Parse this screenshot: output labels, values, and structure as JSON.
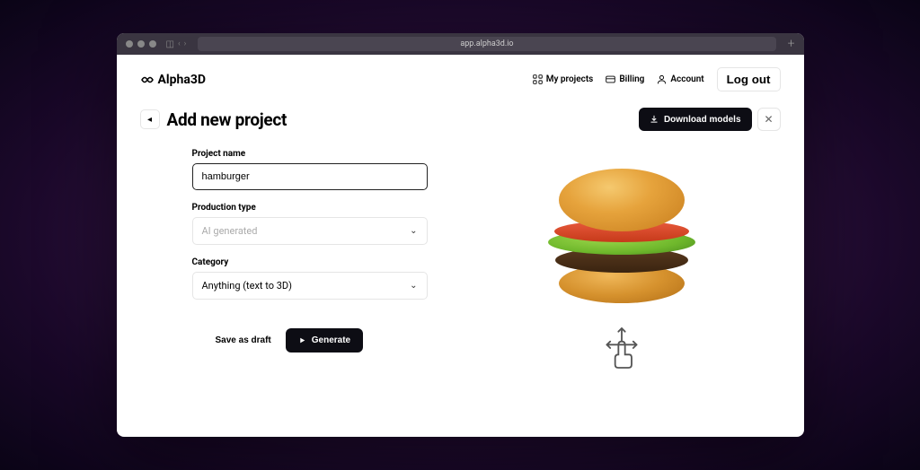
{
  "browser": {
    "url": "app.alpha3d.io"
  },
  "brand": {
    "name": "Alpha3D"
  },
  "nav": {
    "myProjects": "My projects",
    "billing": "Billing",
    "account": "Account",
    "logout": "Log out"
  },
  "page": {
    "title": "Add new project",
    "download": "Download models"
  },
  "form": {
    "projectName": {
      "label": "Project name",
      "value": "hamburger"
    },
    "productionType": {
      "label": "Production type",
      "value": "AI generated"
    },
    "category": {
      "label": "Category",
      "value": "Anything (text to 3D)"
    },
    "saveDraft": "Save as draft",
    "generate": "Generate"
  }
}
